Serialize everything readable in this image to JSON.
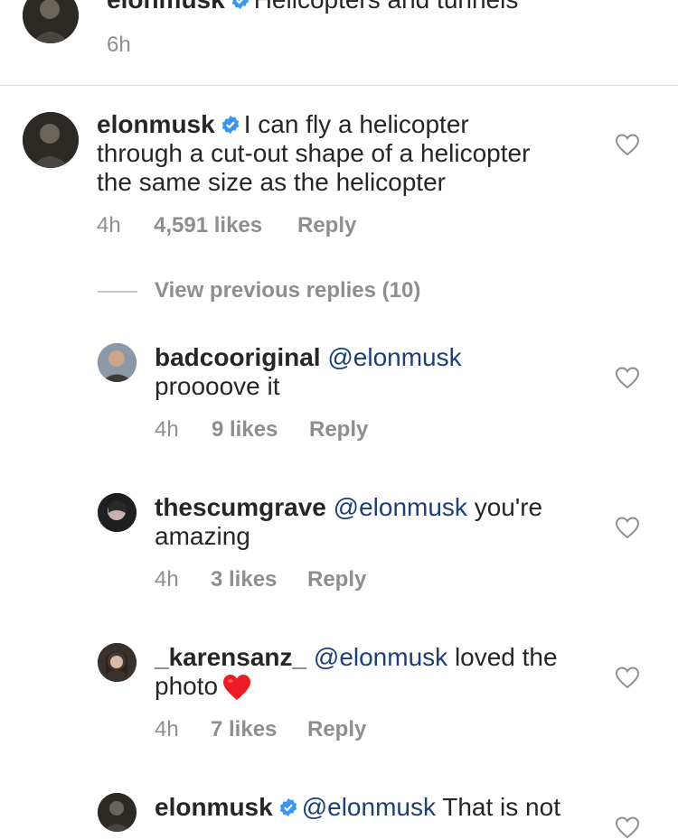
{
  "caption": {
    "username": "elonmusk",
    "text": "Helicopters and tunnels",
    "time": "6h"
  },
  "comments": [
    {
      "username": "elonmusk",
      "verified": true,
      "lines": [
        "I can fly a helicopter",
        "through a cut-out shape of a helicopter",
        "the same size as the helicopter"
      ],
      "time": "4h",
      "likes": "4,591 likes",
      "reply": "Reply"
    }
  ],
  "view_replies": "View previous replies (10)",
  "replies": [
    {
      "username": "badcooriginal",
      "mention": "@elonmusk",
      "line1_rest": "",
      "line2": "proooove it",
      "time": "4h",
      "likes": "9 likes",
      "reply": "Reply"
    },
    {
      "username": "thescumgrave",
      "mention": "@elonmusk",
      "line1_rest": "you're",
      "line2": "amazing",
      "time": "4h",
      "likes": "3 likes",
      "reply": "Reply"
    },
    {
      "username": "_karensanz_",
      "mention": "@elonmusk",
      "line1_rest": "loved the",
      "line2": "photo",
      "emoji": "red-heart",
      "time": "4h",
      "likes": "7 likes",
      "reply": "Reply"
    },
    {
      "username": "elonmusk",
      "verified": true,
      "mention": "@elonmusk",
      "line1_rest": "That is not"
    }
  ],
  "colors": {
    "mention": "#1d3f78",
    "meta": "#8e8e8e",
    "verified": "#3897f0",
    "emoji_heart": "#ed1c24"
  }
}
